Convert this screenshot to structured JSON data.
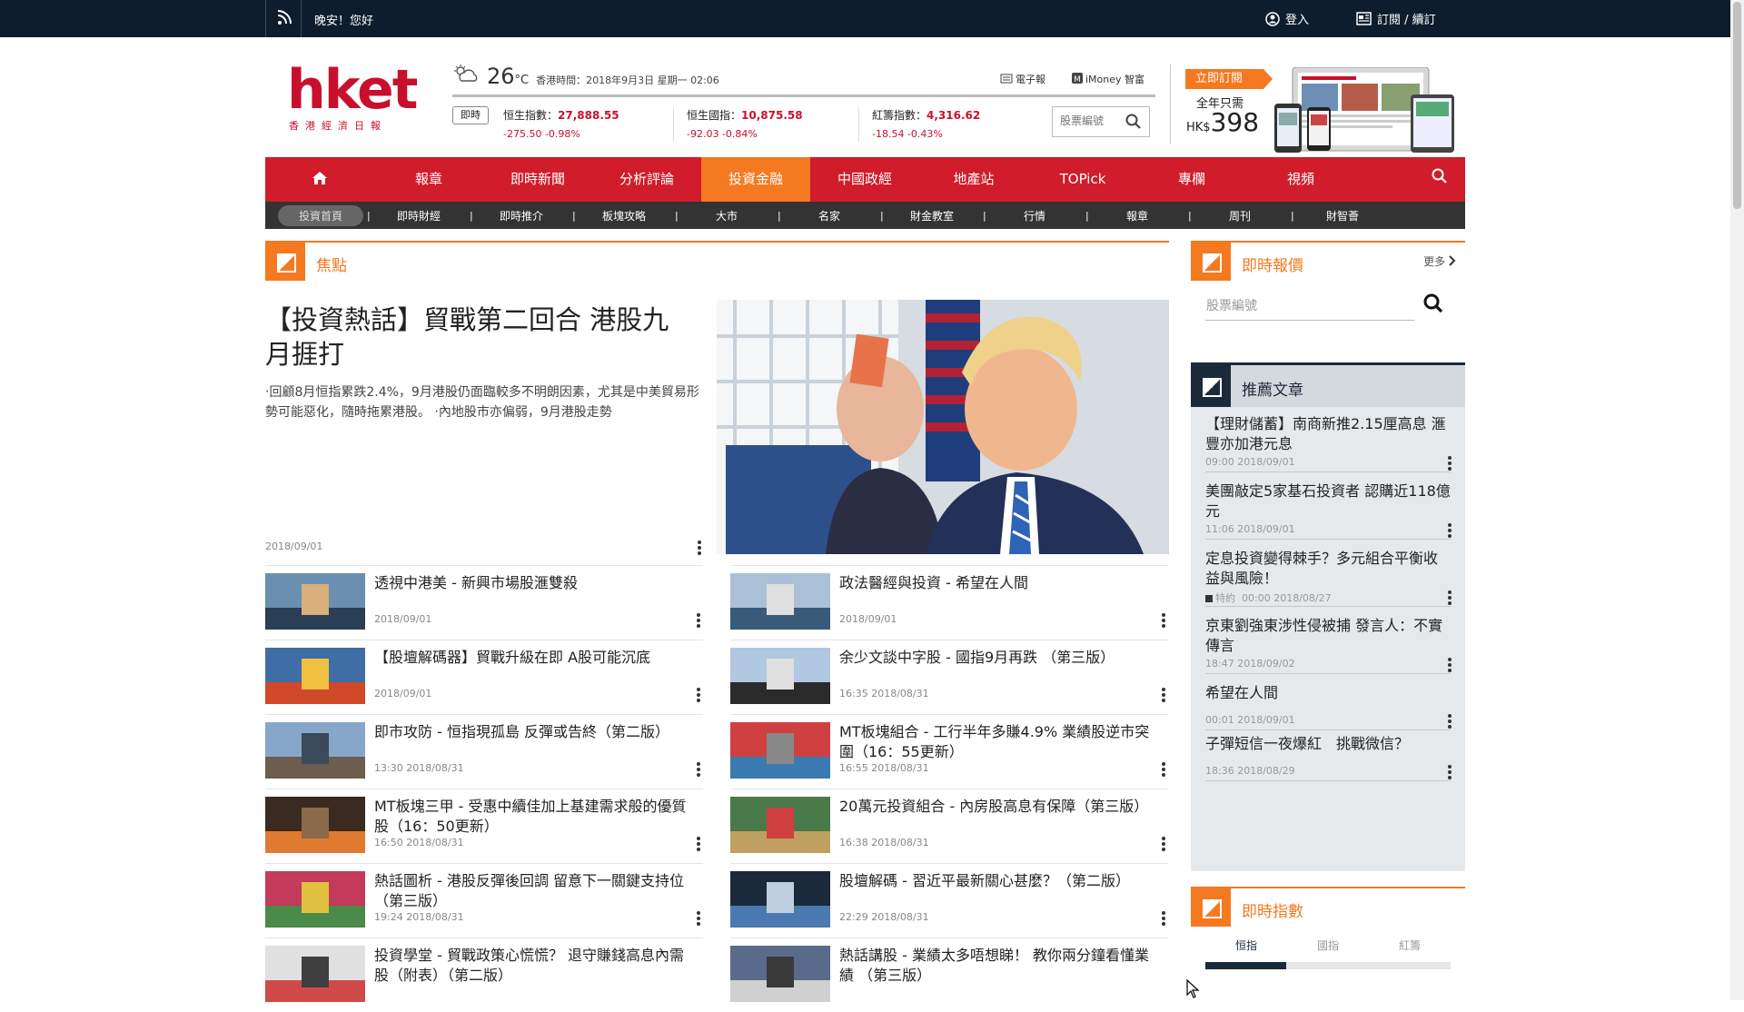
{
  "topbar": {
    "greeting": "晚安！您好",
    "login": "登入",
    "subscribe": "訂閱 / 續訂"
  },
  "logo": {
    "text": "hket",
    "subtitle": "香港經濟日報"
  },
  "weather": {
    "temp": "26",
    "unit": "°C",
    "time": "香港時間：2018年9月3日 星期一 02:06"
  },
  "toplinks": {
    "epaper": "電子報",
    "imoney": "iMoney 智富"
  },
  "live_label": "即時",
  "indices": [
    {
      "name": "恒生指數：",
      "value": "27,888.55",
      "change": "-275.50 -0.98%"
    },
    {
      "name": "恒生國指：",
      "value": "10,875.58",
      "change": "-92.03 -0.84%"
    },
    {
      "name": "紅籌指數：",
      "value": "4,316.62",
      "change": "-18.54 -0.43%"
    }
  ],
  "stock_search_placeholder": "股票編號",
  "promo": {
    "tag": "立即訂閱",
    "line": "全年只需",
    "currency": "HK$",
    "price": "398"
  },
  "mainnav": [
    "報章",
    "即時新聞",
    "分析評論",
    "投資金融",
    "中國政經",
    "地產站",
    "TOPick",
    "專欄",
    "視頻"
  ],
  "mainnav_active": 3,
  "subnav": [
    "投資首頁",
    "即時財經",
    "即時推介",
    "板塊攻略",
    "大市",
    "名家",
    "財金教室",
    "行情",
    "報章",
    "周刊",
    "財智薈"
  ],
  "focus": {
    "title": "焦點",
    "hero": {
      "title": "【投資熱話】貿戰第二回合 港股九月捱打",
      "desc": "‧回顧8月恒指累跌2.4%，9月港股仍面臨較多不明朗因素，尤其是中美貿易形勢可能惡化，隨時拖累港股。 ‧內地股市亦偏弱，9月港股走勢",
      "date": "2018/09/01"
    },
    "left": [
      {
        "title": "透視中港美 - 新興市場股滙雙殺",
        "date": "2018/09/01"
      },
      {
        "title": "【股壇解碼器】貿戰升級在即 A股可能沉底",
        "date": "2018/09/01"
      },
      {
        "title": "即市攻防 - 恒指現孤島 反彈或告終（第二版）",
        "date": "13:30 2018/08/31"
      },
      {
        "title": "MT板塊三甲 - 受惠中續佳加上基建需求般的優質股（16：50更新）",
        "date": "16:50 2018/08/31"
      },
      {
        "title": "熱話圖析 - 港股反彈後回調 留意下一關鍵支持位 （第三版）",
        "date": "19:24 2018/08/31"
      },
      {
        "title": "投資學堂 - 貿戰政策心慌慌？ 退守賺錢高息內需股（附表）（第二版）",
        "date": ""
      }
    ],
    "right": [
      {
        "title": "政法醫經與投資 - 希望在人間",
        "date": "2018/09/01"
      },
      {
        "title": "余少文談中字股 - 國指9月再跌 （第三版）",
        "date": "16:35 2018/08/31"
      },
      {
        "title": "MT板塊組合 - 工行半年多賺4.9% 業績股逆市突圍（16：55更新）",
        "date": "16:55 2018/08/31"
      },
      {
        "title": "20萬元投資組合 - 內房股高息有保障（第三版）",
        "date": "16:38 2018/08/31"
      },
      {
        "title": "股壇解碼 - 習近平最新關心甚麼？（第二版）",
        "date": "22:29 2018/08/31"
      },
      {
        "title": "熱話講股 - 業績太多唔想睇！ 教你兩分鐘看懂業績 （第三版）",
        "date": ""
      }
    ]
  },
  "quotes": {
    "title": "即時報價",
    "more": "更多",
    "placeholder": "股票編號"
  },
  "recommended": {
    "title": "推薦文章",
    "items": [
      {
        "title": "【理財儲蓄】南商新推2.15厘高息 滙豐亦加港元息",
        "date": "09:00 2018/09/01",
        "tag": ""
      },
      {
        "title": "美團敲定5家基石投資者 認購近118億元",
        "date": "11:06 2018/09/01",
        "tag": ""
      },
      {
        "title": "定息投資變得棘手？多元組合平衡收益與風險！",
        "date": "00:00 2018/08/27",
        "tag": "特約"
      },
      {
        "title": "京東劉強東涉性侵被捕 發言人：不實傳言",
        "date": "18:47 2018/09/02",
        "tag": ""
      },
      {
        "title": "希望在人間",
        "date": "00:01 2018/09/01",
        "tag": ""
      },
      {
        "title": "子彈短信一夜爆紅　挑戰微信？",
        "date": "18:36 2018/08/29",
        "tag": ""
      }
    ]
  },
  "live_index": {
    "title": "即時指數",
    "tabs": [
      "恒指",
      "國指",
      "紅籌"
    ],
    "active": 0,
    "progress": 0.33
  }
}
